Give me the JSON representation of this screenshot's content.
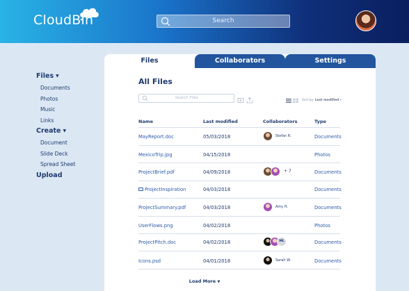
{
  "app": {
    "name": "CloudBin"
  },
  "search": {
    "placeholder": "Search"
  },
  "tabs": [
    {
      "label": "Files"
    },
    {
      "label": "Collaborators"
    },
    {
      "label": "Settings"
    }
  ],
  "sidebar": {
    "files": {
      "label": "Files",
      "items": [
        "Documents",
        "Photos",
        "Music",
        "Links"
      ]
    },
    "create": {
      "label": "Create",
      "items": [
        "Document",
        "Slide Deck",
        "Spread Sheet"
      ]
    },
    "upload": {
      "label": "Upload"
    }
  },
  "main": {
    "title": "All Files",
    "search_placeholder": "Search Files",
    "sort_prefix": "Sort by:",
    "sort_value": "Last modified"
  },
  "table": {
    "headers": {
      "name": "Name",
      "modified": "Last modified",
      "collaborators": "Collaborators",
      "type": "Type"
    },
    "rows": [
      {
        "name": "MayReport.doc",
        "date": "05/03/2018",
        "collab_label": "Stefan R.",
        "type": "Documents"
      },
      {
        "name": "MexicoTrip.jpg",
        "date": "04/15/2018",
        "collab_label": "",
        "type": "Photos"
      },
      {
        "name": "ProjectBrief.pdf",
        "date": "04/09/2018",
        "collab_label": "+ 7",
        "type": "Documents"
      },
      {
        "name": "ProjectInspiration",
        "date": "04/03/2018",
        "collab_label": "",
        "type": "Documents",
        "folder": true
      },
      {
        "name": "ProjectSummary.pdf",
        "date": "04/03/2018",
        "collab_label": "Amy H.",
        "type": "Documents"
      },
      {
        "name": "UserFlows.png",
        "date": "04/02/2018",
        "collab_label": "",
        "type": "Photos"
      },
      {
        "name": "ProjectPitch.doc",
        "date": "04/02/2018",
        "collab_label": "",
        "collab_badge": "ML",
        "type": "Documents"
      },
      {
        "name": "Icons.psd",
        "date": "04/01/2018",
        "collab_label": "Sarah W.",
        "type": "Documents"
      }
    ]
  },
  "load_more": "Load More",
  "colors": {
    "accent": "#22559e",
    "text": "#1e3a6e",
    "link": "#2a5aa8",
    "background": "#dbe8f4"
  }
}
